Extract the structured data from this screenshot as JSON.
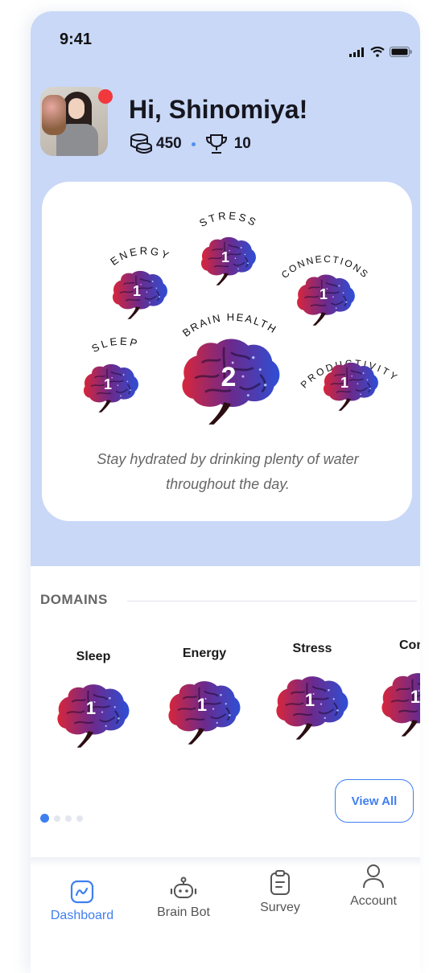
{
  "status": {
    "time": "9:41"
  },
  "user": {
    "greeting": "Hi, Shinomiya!",
    "coins": "450",
    "trophies": "10"
  },
  "wheel": {
    "brains": [
      {
        "label": "STRESS",
        "score": "1"
      },
      {
        "label": "ENERGY",
        "score": "1"
      },
      {
        "label": "CONNECTIONS",
        "score": "1"
      },
      {
        "label": "SLEEP",
        "score": "1"
      },
      {
        "label": "BRAIN HEALTH",
        "score": "2"
      },
      {
        "label": "PRODUCTIVITY",
        "score": "1"
      }
    ],
    "tip": "Stay hydrated by drinking plenty of water throughout the day."
  },
  "domains": {
    "title": "DOMAINS",
    "items": [
      {
        "label": "Sleep",
        "score": "1"
      },
      {
        "label": "Energy",
        "score": "1"
      },
      {
        "label": "Stress",
        "score": "1"
      },
      {
        "label": "Con",
        "score": "1"
      }
    ],
    "view_all": "View All"
  },
  "nav": {
    "items": [
      {
        "label": "Dashboard",
        "icon": "dashboard-icon"
      },
      {
        "label": "Brain Bot",
        "icon": "robot-icon"
      },
      {
        "label": "Survey",
        "icon": "clipboard-icon"
      },
      {
        "label": "Account",
        "icon": "user-icon"
      }
    ]
  },
  "colors": {
    "accent": "#3f7ff0",
    "header_bg": "#c9d8f7",
    "notification": "#f0383d"
  }
}
